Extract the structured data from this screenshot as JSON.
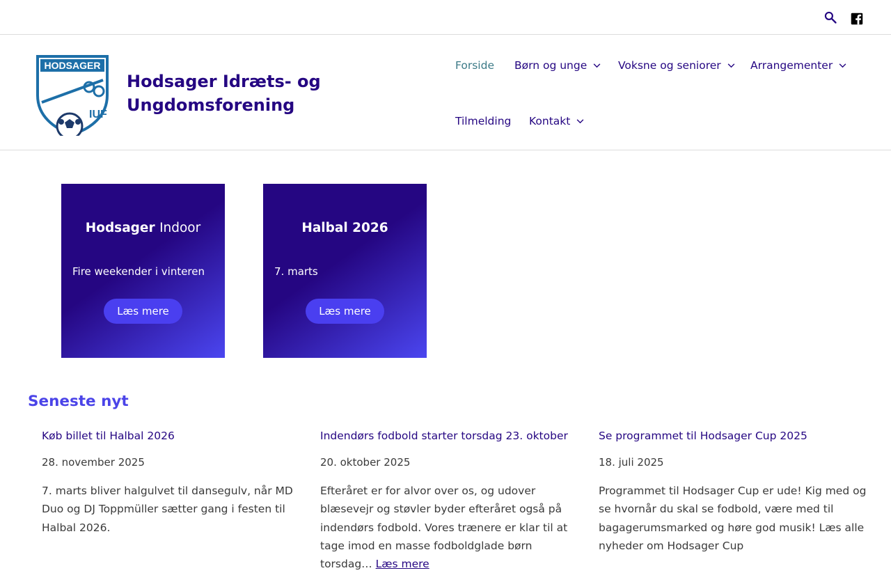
{
  "topbar": {
    "search_icon": "search-icon",
    "social_icon": "facebook-icon"
  },
  "header": {
    "logo": {
      "text_top": "HODSAGER",
      "text_bottom": "IUF"
    },
    "site_title": "Hodsager Idræts- og Ungdomsforening",
    "nav": [
      {
        "label": "Forside",
        "active": true,
        "has_submenu": false
      },
      {
        "label": "Børn og unge",
        "active": false,
        "has_submenu": true
      },
      {
        "label": "Voksne og seniorer",
        "active": false,
        "has_submenu": true
      },
      {
        "label": "Arrangementer",
        "active": false,
        "has_submenu": true
      },
      {
        "label": "Tilmelding",
        "active": false,
        "has_submenu": false
      },
      {
        "label": "Kontakt",
        "active": false,
        "has_submenu": true
      }
    ]
  },
  "cards": [
    {
      "title_bold": "Hodsager",
      "title_light": "Indoor",
      "subtitle": "Fire weekender i vinteren",
      "button": "Læs mere"
    },
    {
      "title_bold": "Halbal 2026",
      "title_light": "",
      "subtitle": "7. marts",
      "button": "Læs mere"
    }
  ],
  "news": {
    "heading": "Seneste nyt",
    "posts": [
      {
        "title": "Køb billet til Halbal 2026",
        "date": "28. november 2025",
        "excerpt": "7. marts bliver halgulvet til dansegulv, når MD Duo og DJ Toppmüller sætter gang i festen til Halbal 2026.",
        "read_more": ""
      },
      {
        "title": "Indendørs fodbold starter torsdag 23. oktober",
        "date": "20. oktober 2025",
        "excerpt": "Efteråret er for alvor over os, og udover blæsevejr og støvler byder efteråret også på indendørs fodbold. Vores trænere er klar til at tage imod en masse fodboldglade børn torsdag…",
        "read_more": "Læs mere"
      },
      {
        "title": "Se programmet til Hodsager Cup 2025",
        "date": "18. juli 2025",
        "excerpt": "Programmet til Hodsager Cup er ude! Kig med og se hvornår du skal se fodbold, være med til bagagerumsmarked og høre god musik! Læs alle nyheder om Hodsager Cup",
        "read_more": ""
      }
    ]
  },
  "colors": {
    "brand": "#250682",
    "accent": "#4b44e8",
    "active_nav": "#3C7A87"
  }
}
